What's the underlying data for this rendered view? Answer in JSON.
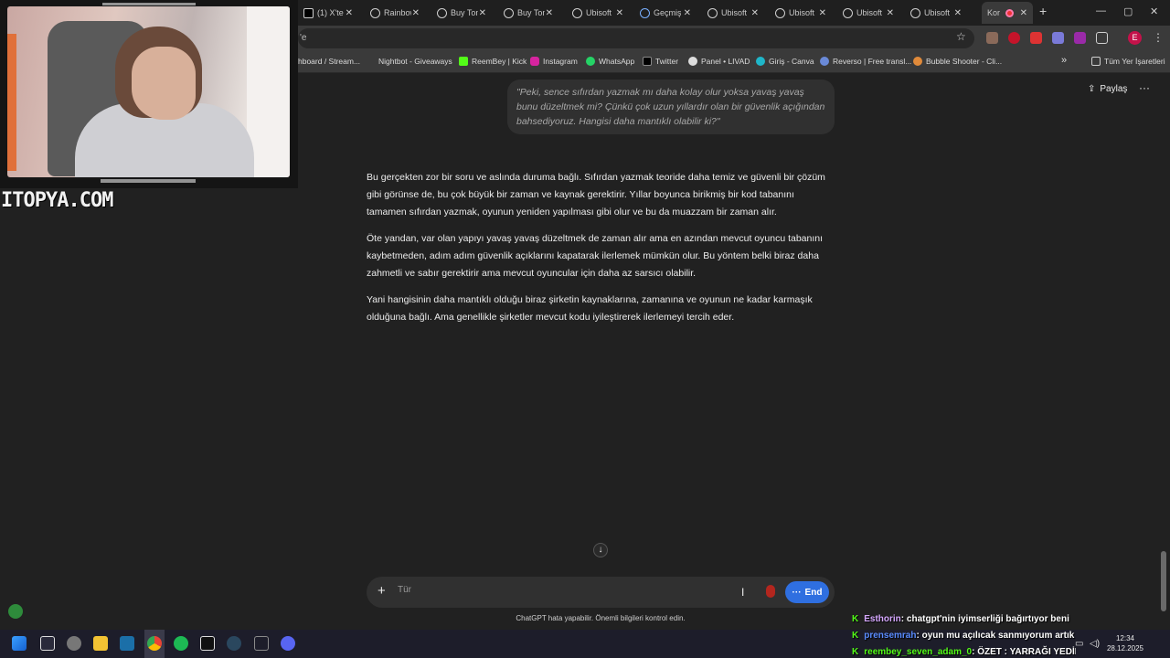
{
  "tabs": [
    {
      "title": "(1) X'te",
      "close": "✕"
    },
    {
      "title": "Rainbow",
      "close": "✕"
    },
    {
      "title": "Buy Tom",
      "close": "✕"
    },
    {
      "title": "Buy Tom",
      "close": "✕"
    },
    {
      "title": "Ubisoft",
      "close": "✕"
    },
    {
      "title": "Geçmiş",
      "close": "✕"
    },
    {
      "title": "Ubisoft",
      "close": "✕"
    },
    {
      "title": "Ubisoft",
      "close": "✕"
    },
    {
      "title": "Ubisoft",
      "close": "✕"
    },
    {
      "title": "Ubisoft",
      "close": "✕"
    },
    {
      "title": "Kor",
      "close": "✕"
    }
  ],
  "window": {
    "new_tab": "+",
    "minimize": "—",
    "maximize": "▢",
    "close": "✕"
  },
  "address": {
    "url_fragment": "'e",
    "star": "☆",
    "profile_initial": "E",
    "menu": "⋮"
  },
  "bookmarks": {
    "items": [
      "hboard / Stream...",
      "Nightbot - Giveaways",
      "ReemBey | Kick",
      "Instagram",
      "WhatsApp",
      "Twitter",
      "Panel • LIVAD",
      "Giriş - Canva",
      "Reverso | Free transl...",
      "Bubble Shooter - Cli..."
    ],
    "more": "»",
    "all_bookmarks": "Tüm Yer İşaretleri"
  },
  "page": {
    "share_label": "Paylaş",
    "menu": "···",
    "user_message": "\"Peki, sence sıfırdan yazmak mı daha kolay olur yoksa yavaş yavaş bunu düzeltmek mi? Çünkü çok uzun yıllardır olan bir güvenlik açığından bahsediyoruz. Hangisi daha mantıklı olabilir ki?\"",
    "answer": [
      "Bu gerçekten zor bir soru ve aslında duruma bağlı. Sıfırdan yazmak teoride daha temiz ve güvenli bir çözüm gibi görünse de, bu çok büyük bir zaman ve kaynak gerektirir. Yıllar boyunca birikmiş bir kod tabanını tamamen sıfırdan yazmak, oyunun yeniden yapılması gibi olur ve bu da muazzam bir zaman alır.",
      "Öte yandan, var olan yapıyı yavaş yavaş düzeltmek de zaman alır ama en azından mevcut oyuncu tabanını kaybetmeden, adım adım güvenlik açıklarını kapatarak ilerlemek mümkün olur. Bu yöntem belki biraz daha zahmetli ve sabır gerektirir ama mevcut oyuncular için daha az sarsıcı olabilir.",
      "Yani hangisinin daha mantıklı olduğu biraz şirketin kaynaklarına, zamanına ve oyunun ne kadar karmaşık olduğuna bağlı. Ama genellikle şirketler mevcut kodu iyileştirerek ilerlemeyi tercih eder."
    ],
    "scroll_down": "↓",
    "composer": {
      "plus": "+",
      "placeholder": "Tür",
      "end_label": "End",
      "end_dots": "···"
    },
    "disclaimer": "ChatGPT hata yapabilir. Önemli bilgileri kontrol edin."
  },
  "overlay": {
    "logo_text": "ITOPYA.COM",
    "chat": [
      {
        "user": "Esthorin",
        "user_color": "#d6a8ff",
        "text": ": chatgpt'nin iyimserliği bağırtıyor beni"
      },
      {
        "user": "prensemrah",
        "user_color": "#5a8cff",
        "text": ": oyun mu açılıcak sanmıyorum artık"
      },
      {
        "user": "reembey_seven_adam_0",
        "user_color": "#53fc18",
        "text": ": ÖZET : YARRAĞI YEDİK"
      }
    ]
  },
  "taskbar": {
    "time": "12:34",
    "date": "28.12.2025"
  },
  "colors": {
    "page_bg": "#212121",
    "accent_blue": "#2f6fe0",
    "kick_green": "#53fc18"
  }
}
